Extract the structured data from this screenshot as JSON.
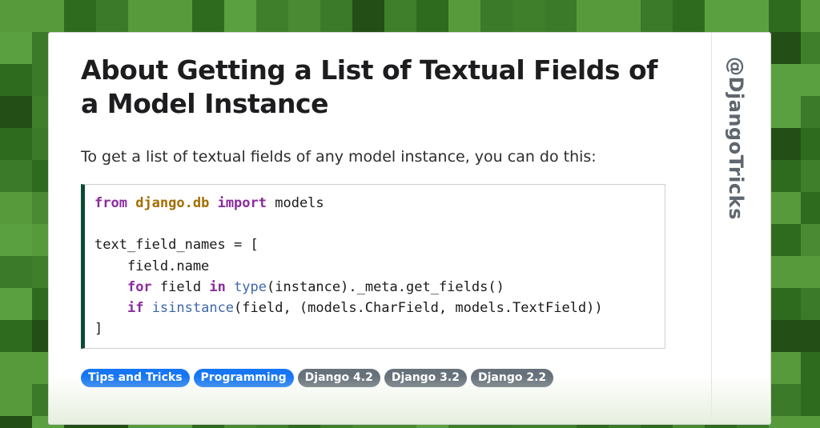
{
  "article": {
    "title": "About Getting a List of Textual Fields of a Model Instance",
    "intro": "To get a list of textual fields of any model instance, you can do this:"
  },
  "code": {
    "line1": {
      "kw_from": "from",
      "module": "django.db",
      "kw_import": "import",
      "rest": " models"
    },
    "line3": "text_field_names = [",
    "line4": "    field.name",
    "line5": {
      "indent": "    ",
      "kw_for": "for",
      "mid1": " field ",
      "kw_in": "in",
      "sp": " ",
      "builtin_type": "type",
      "rest": "(instance)._meta.get_fields()"
    },
    "line6": {
      "indent": "    ",
      "kw_if": "if",
      "sp": " ",
      "builtin_isinstance": "isinstance",
      "rest": "(field, (models.CharField, models.TextField))"
    },
    "line7": "]"
  },
  "tags": [
    {
      "label": "Tips and Tricks"
    },
    {
      "label": "Programming"
    },
    {
      "label": "Django 4.2"
    },
    {
      "label": "Django 3.2"
    },
    {
      "label": "Django 2.2"
    }
  ],
  "brand": {
    "handle": "@DjangoTricks"
  },
  "colors": {
    "background": "#4a8a33",
    "accent_dark_green": "#0c4b33",
    "tag_primary": "#1676f3",
    "tag_secondary": "#67717b",
    "keyword": "#8b2b9e",
    "module": "#a36d00",
    "builtin": "#3f67a9"
  }
}
